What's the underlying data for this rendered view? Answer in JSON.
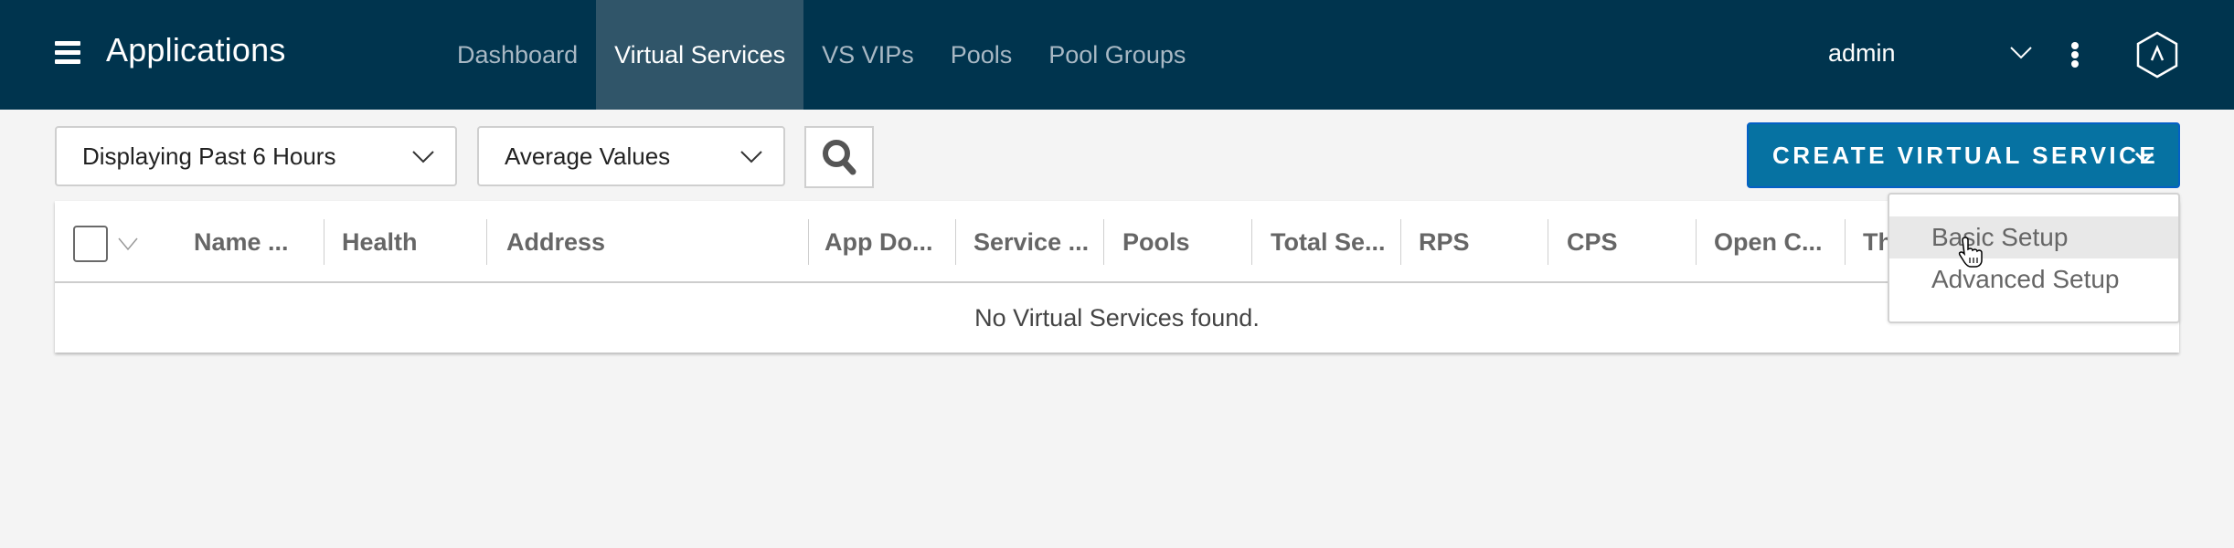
{
  "header": {
    "title": "Applications",
    "nav": [
      {
        "label": "Dashboard",
        "active": false
      },
      {
        "label": "Virtual Services",
        "active": true
      },
      {
        "label": "VS VIPs",
        "active": false
      },
      {
        "label": "Pools",
        "active": false
      },
      {
        "label": "Pool Groups",
        "active": false
      }
    ],
    "user": "admin",
    "icons": {
      "menu": "hamburger-icon",
      "user_menu": "chevron-down-icon",
      "more": "kebab-icon",
      "logo": "hexagon-logo-icon"
    }
  },
  "toolbar": {
    "time_range": "Displaying Past 6 Hours",
    "value_mode": "Average Values",
    "search_icon": "search-icon",
    "create_label": "CREATE VIRTUAL SERVICE"
  },
  "create_menu": {
    "items": [
      {
        "label": "Basic Setup",
        "hovered": true
      },
      {
        "label": "Advanced Setup",
        "hovered": false
      }
    ]
  },
  "table": {
    "columns": [
      "Name ...",
      "Health",
      "Address",
      "App Do...",
      "Service ...",
      "Pools",
      "Total Se...",
      "RPS",
      "CPS",
      "Open C...",
      "Th"
    ],
    "empty_message": "No Virtual Services found."
  },
  "colors": {
    "header_bg": "#00344e",
    "active_tab_bg": "#305569",
    "primary_button": "#0672a2",
    "page_bg": "#f4f4f4"
  }
}
